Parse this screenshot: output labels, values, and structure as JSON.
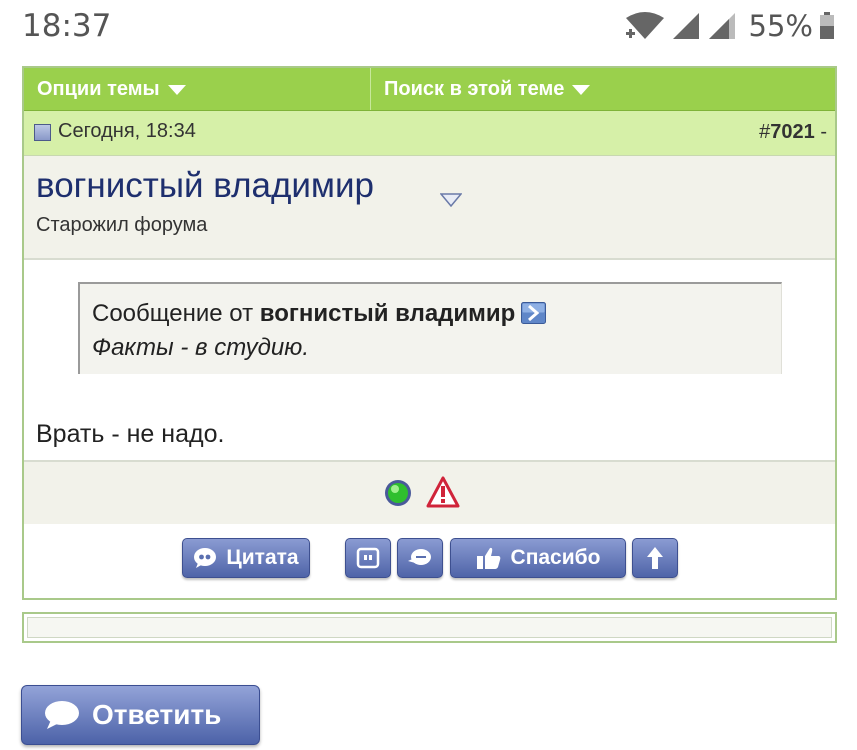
{
  "status_bar": {
    "time": "18:37",
    "battery": "55%"
  },
  "toolbar": {
    "thread_options": "Опции темы",
    "search_thread": "Поиск в этой теме"
  },
  "post": {
    "date": "Сегодня, 18:34",
    "number_prefix": "#",
    "number": "7021",
    "number_suffix": " -",
    "username": "вогнистый владимир",
    "user_title": "Старожил форума",
    "quote": {
      "prefix": "Сообщение от ",
      "author": "вогнистый владимир",
      "text": "Факты - в студию."
    },
    "message": "Врать - не надо."
  },
  "actions": {
    "quote_label": "Цитата",
    "thanks_label": "Спасибо"
  },
  "reply": {
    "label": "Ответить"
  },
  "colors": {
    "toolbar_green": "#9ad04c",
    "post_head_green": "#d6f0a8",
    "button_blue": "#5a6fb0",
    "username_blue": "#1e2f6e"
  }
}
